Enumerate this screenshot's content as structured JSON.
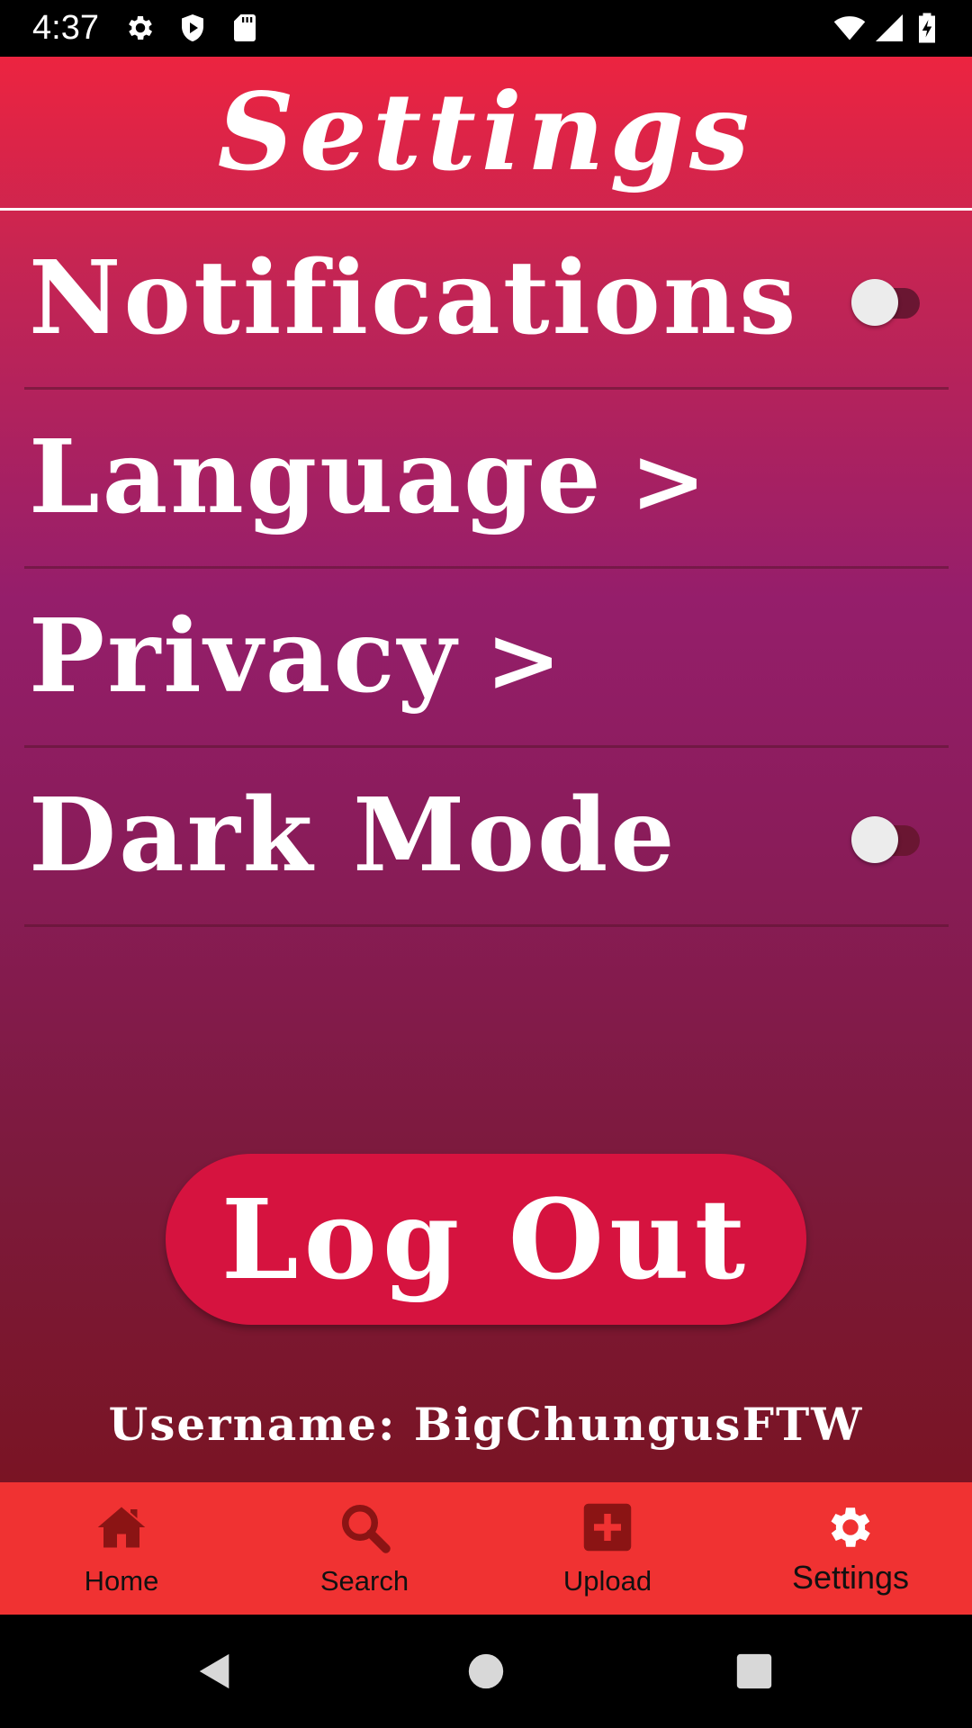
{
  "status_bar": {
    "time": "4:37",
    "icons": [
      "gear-icon",
      "shield-play-icon",
      "sd-card-icon",
      "wifi-icon",
      "signal-icon",
      "battery-charging-icon"
    ]
  },
  "header": {
    "title": "Settings"
  },
  "settings": {
    "items": [
      {
        "label": "Notifications",
        "type": "toggle",
        "enabled": false
      },
      {
        "label": "Language",
        "type": "link",
        "chevron": ">"
      },
      {
        "label": "Privacy",
        "type": "link",
        "chevron": ">"
      },
      {
        "label": "Dark Mode",
        "type": "toggle",
        "enabled": false
      }
    ]
  },
  "logout": {
    "label": "Log Out"
  },
  "account": {
    "username_text": "Username: BigChungusFTW"
  },
  "bottom_nav": {
    "items": [
      {
        "label": "Home",
        "icon": "home-icon",
        "active": false
      },
      {
        "label": "Search",
        "icon": "search-icon",
        "active": false
      },
      {
        "label": "Upload",
        "icon": "upload-plus-icon",
        "active": false
      },
      {
        "label": "Settings",
        "icon": "gear-icon",
        "active": true
      }
    ]
  },
  "colors": {
    "header_red": "#ec2440",
    "gradient_purple": "#951e6b",
    "gradient_bottom": "#7a1424",
    "logout_button": "#d6133f",
    "bottom_nav_bg": "#f03232",
    "nav_icon_inactive": "#8b1414",
    "nav_icon_active": "#ffffff"
  },
  "system_nav": {
    "buttons": [
      "back-icon",
      "home-circle-icon",
      "recents-icon"
    ]
  }
}
